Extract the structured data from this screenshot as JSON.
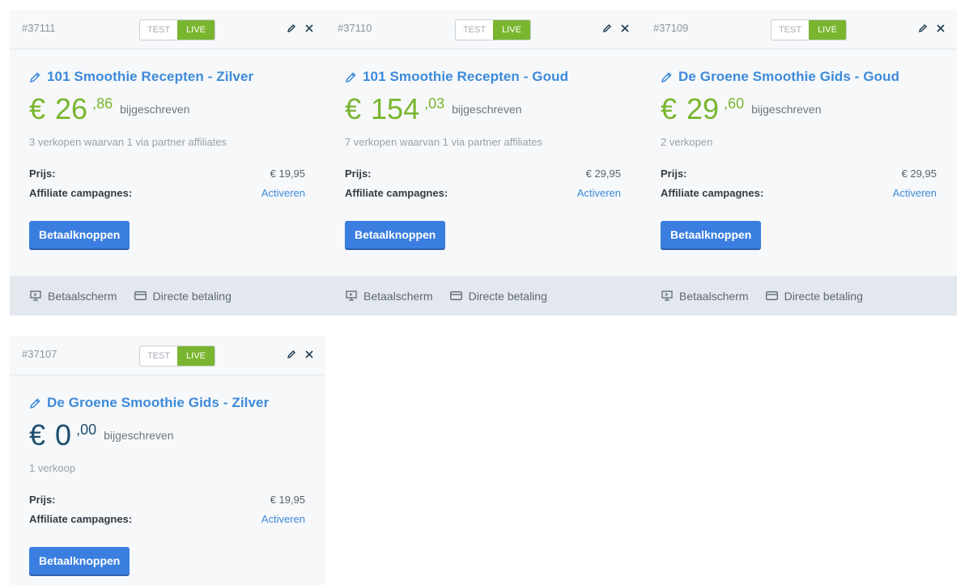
{
  "cards": [
    {
      "id": "#37111",
      "test_label": "TEST",
      "live_label": "LIVE",
      "title": "101 Smoothie Recepten - Zilver",
      "currency": "€",
      "amount": "26",
      "cents": ",86",
      "written": "bijgeschreven",
      "sales": "3 verkopen waarvan 1 via partner affiliates",
      "price_label": "Prijs:",
      "price": "€ 19,95",
      "affiliate_label": "Affiliate campagnes:",
      "affiliate_link": "Activeren",
      "button": "Betaalknoppen",
      "foot_screen": "Betaalscherm",
      "foot_direct": "Directe betaling"
    },
    {
      "id": "#37110",
      "test_label": "TEST",
      "live_label": "LIVE",
      "title": "101 Smoothie Recepten - Goud",
      "currency": "€",
      "amount": "154",
      "cents": ",03",
      "written": "bijgeschreven",
      "sales": "7 verkopen waarvan 1 via partner affiliates",
      "price_label": "Prijs:",
      "price": "€ 29,95",
      "affiliate_label": "Affiliate campagnes:",
      "affiliate_link": "Activeren",
      "button": "Betaalknoppen",
      "foot_screen": "Betaalscherm",
      "foot_direct": "Directe betaling"
    },
    {
      "id": "#37109",
      "test_label": "TEST",
      "live_label": "LIVE",
      "title": "De Groene Smoothie Gids - Goud",
      "currency": "€",
      "amount": "29",
      "cents": ",60",
      "written": "bijgeschreven",
      "sales": "2 verkopen",
      "price_label": "Prijs:",
      "price": "€ 29,95",
      "affiliate_label": "Affiliate campagnes:",
      "affiliate_link": "Activeren",
      "button": "Betaalknoppen",
      "foot_screen": "Betaalscherm",
      "foot_direct": "Directe betaling"
    },
    {
      "id": "#37107",
      "test_label": "TEST",
      "live_label": "LIVE",
      "title": "De Groene Smoothie Gids - Zilver",
      "currency": "€",
      "amount": "0",
      "cents": ",00",
      "written": "bijgeschreven",
      "sales": "1 verkoop",
      "price_label": "Prijs:",
      "price": "€ 19,95",
      "affiliate_label": "Affiliate campagnes:",
      "affiliate_link": "Activeren",
      "button": "Betaalknoppen"
    }
  ],
  "colors": {
    "accent_blue": "#3d8ad9",
    "button_blue": "#3a7ee0",
    "live_green": "#7ab52f",
    "zero_amount": "#1d4d6d"
  },
  "icons": {
    "edit": "pencil-icon",
    "close": "close-icon",
    "title_edit": "pencil-icon",
    "foot_screen": "monitor-icon",
    "foot_direct": "credit-card-icon"
  }
}
